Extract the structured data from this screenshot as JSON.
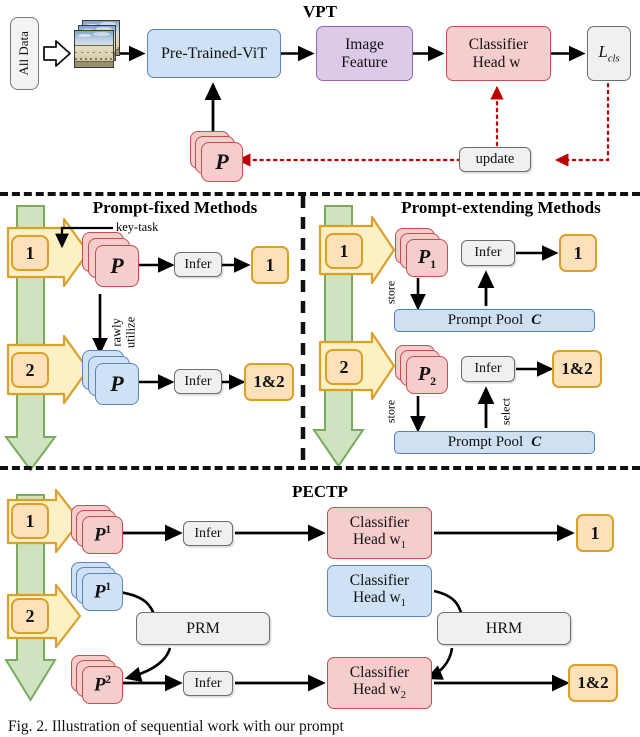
{
  "sections": {
    "vpt": {
      "title": "VPT",
      "all_data": "All Data",
      "photo_alt": "dataset-image-thumbnail",
      "backbone": "Pre-Trained-ViT",
      "image_feature_l1": "Image",
      "image_feature_l2": "Feature",
      "classifier_l1": "Classifier",
      "classifier_l2": "Head w",
      "loss": "L",
      "loss_sub": "cls",
      "prompt": "P",
      "update": "update"
    },
    "prompt_fixed": {
      "title": "Prompt-fixed Methods",
      "key_task_label": "key-task",
      "task1": "1",
      "task2": "2",
      "prompt1": "P",
      "prompt2": "P",
      "infer1": "Infer",
      "infer2": "Infer",
      "out1": "1",
      "out2": "1&2",
      "edge_label_l1": "rawly",
      "edge_label_l2": "utilize"
    },
    "prompt_extending": {
      "title": "Prompt-extending Methods",
      "task1": "1",
      "task2": "2",
      "prompt1": "P",
      "prompt1_sub": "1",
      "prompt2": "P",
      "prompt2_sub": "2",
      "infer1": "Infer",
      "infer2": "Infer",
      "out1": "1",
      "out2": "1&2",
      "pool1": "Prompt Pool",
      "pool1_sym": "C",
      "pool2": "Prompt Pool",
      "pool2_sym": "C",
      "store1": "store",
      "store2": "store",
      "select": "select"
    },
    "pectp": {
      "title": "PECTP",
      "task1": "1",
      "task2": "2",
      "prompt_red1": "P",
      "prompt_red1_sup": "1",
      "prompt_blue1": "P",
      "prompt_blue1_sup": "1",
      "prompt_red2": "P",
      "prompt_red2_sup": "2",
      "infer1": "Infer",
      "infer2": "Infer",
      "head_red1_l1": "Classifier",
      "head_red1_l2": "Head w",
      "head_red1_sub": "1",
      "head_blue_l1": "Classifier",
      "head_blue_l2": "Head w",
      "head_blue_sub": "1",
      "head_red2_l1": "Classifier",
      "head_red2_l2": "Head w",
      "head_red2_sub": "2",
      "prm": "PRM",
      "hrm": "HRM",
      "out1": "1",
      "out2": "1&2"
    }
  },
  "caption": "Fig. 2.  Illustration of sequential work with our prompt",
  "colors": {
    "blue_fill": "#cfe1f5",
    "blue_stroke": "#5b84bd",
    "purple_fill": "#ddc9e8",
    "purple_stroke": "#8e6aa8",
    "red_fill": "#f5cdcd",
    "red_stroke": "#c0504d",
    "grey_fill": "#f0f0f0",
    "grey_stroke": "#6d6d6d",
    "gold_fill": "#fde1bb",
    "gold_stroke": "#d9a12a",
    "green_fill": "#cfe3c0",
    "green_stroke": "#7aab5e",
    "yellow_fill": "#fdf0c4",
    "yellow_stroke": "#d9a12a",
    "dotted_red": "#c00000",
    "arrow_black": "#000000"
  }
}
